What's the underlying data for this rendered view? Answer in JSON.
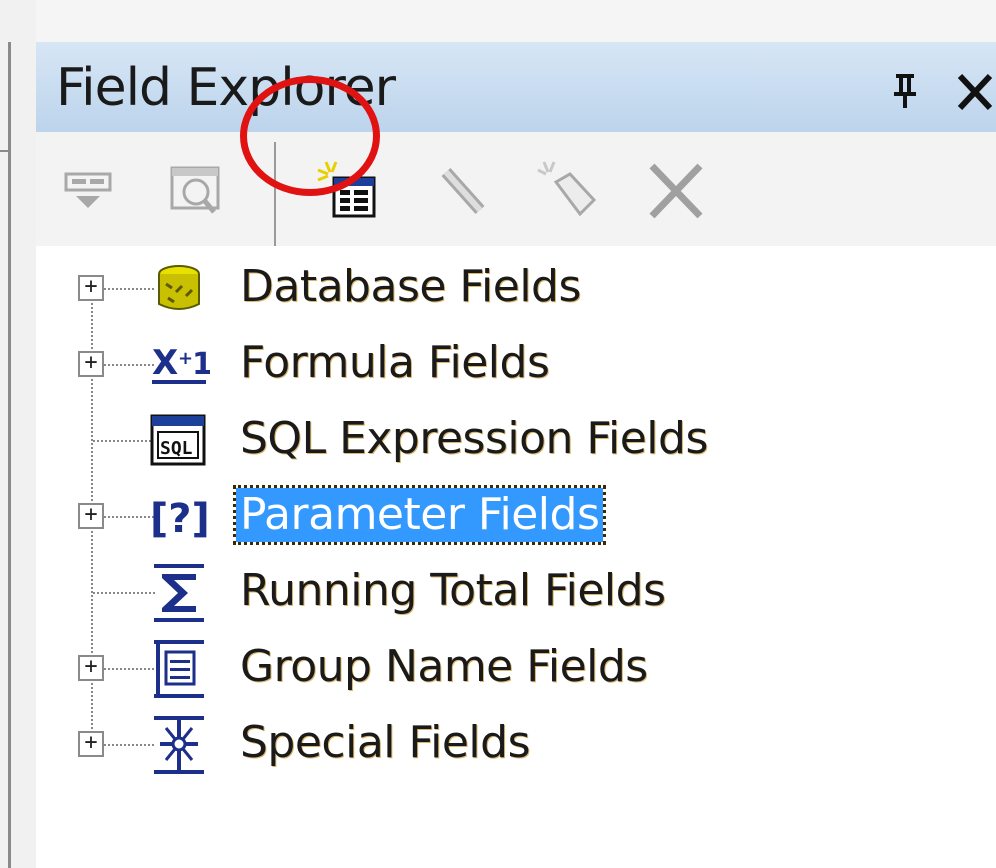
{
  "panel": {
    "title": "Field Explorer"
  },
  "toolbar": {
    "buttons": [
      {
        "name": "insert-to-report",
        "icon": "insert-field-icon",
        "enabled": false
      },
      {
        "name": "browse",
        "icon": "browse-icon",
        "enabled": false
      },
      {
        "name": "new",
        "icon": "new-field-icon",
        "enabled": true,
        "highlighted": true
      },
      {
        "name": "edit",
        "icon": "pencil-icon",
        "enabled": false
      },
      {
        "name": "rename",
        "icon": "rename-tag-icon",
        "enabled": false
      },
      {
        "name": "delete",
        "icon": "delete-x-icon",
        "enabled": false
      }
    ]
  },
  "tree": {
    "items": [
      {
        "label": "Database Fields",
        "icon": "database-icon",
        "expandable": true
      },
      {
        "label": "Formula Fields",
        "icon": "formula-icon",
        "expandable": true
      },
      {
        "label": "SQL Expression Fields",
        "icon": "sql-icon",
        "expandable": false
      },
      {
        "label": "Parameter Fields",
        "icon": "parameter-icon",
        "expandable": true,
        "selected": true
      },
      {
        "label": "Running Total Fields",
        "icon": "sigma-icon",
        "expandable": false
      },
      {
        "label": "Group Name Fields",
        "icon": "group-name-icon",
        "expandable": true
      },
      {
        "label": "Special Fields",
        "icon": "special-fields-icon",
        "expandable": true
      }
    ]
  },
  "colors": {
    "titlebar": "#c9dcf0",
    "selection": "#3399ff",
    "highlight_ring": "#e01212"
  }
}
